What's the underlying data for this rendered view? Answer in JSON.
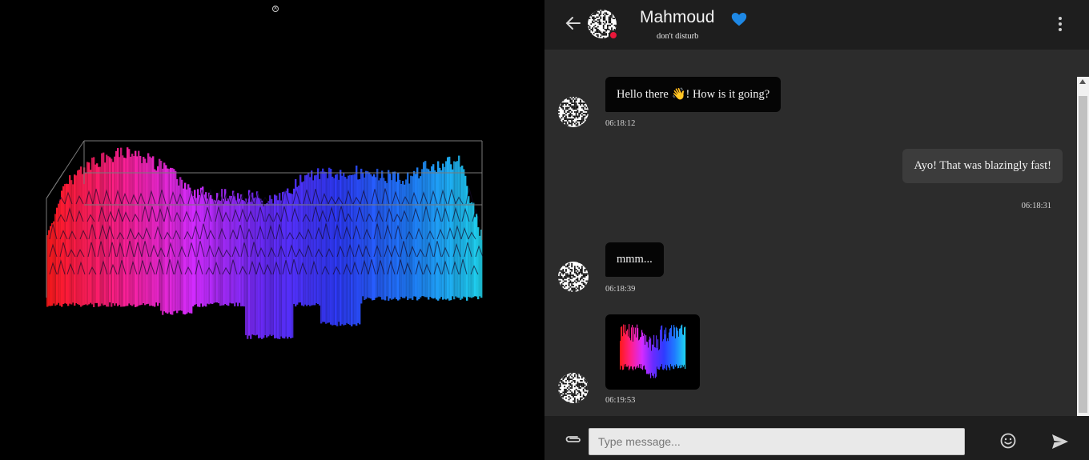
{
  "contact": {
    "name": "Mahmoud",
    "status": "don't disturb",
    "status_color": "#e8173a",
    "favorite_icon": "heart-icon",
    "favorite_color": "#1e88e5"
  },
  "header": {
    "back_icon": "arrow-left-icon",
    "menu_icon": "more-vertical-icon"
  },
  "viewer": {
    "close_icon": "close-circle-icon",
    "content": "3d-bar-visualization",
    "gradient_colors": [
      "#ff1a1a",
      "#ff1f8f",
      "#d52bff",
      "#6a2bff",
      "#2f3bff",
      "#1f7dff",
      "#1fd6f0"
    ]
  },
  "messages": [
    {
      "direction": "in",
      "type": "text",
      "text": "Hello there 👋! How is it going?",
      "time": "06:18:12"
    },
    {
      "direction": "out",
      "type": "text",
      "text": "Ayo! That was blazingly fast!",
      "time": "06:18:31"
    },
    {
      "direction": "in",
      "type": "text",
      "text": "mmm...",
      "time": "06:18:39"
    },
    {
      "direction": "in",
      "type": "image",
      "text": "",
      "time": "06:19:53"
    }
  ],
  "composer": {
    "placeholder": "Type message...",
    "value": "",
    "attach_icon": "paperclip-icon",
    "emoji_icon": "smiley-icon",
    "send_icon": "send-icon"
  }
}
